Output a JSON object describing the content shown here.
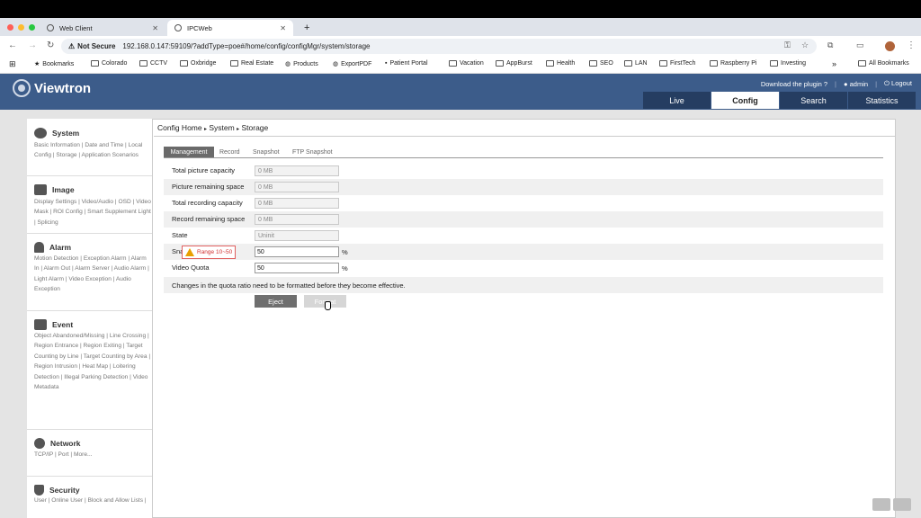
{
  "browser": {
    "tabs": [
      {
        "title": "Web Client"
      },
      {
        "title": "IPCWeb"
      }
    ],
    "new_tab": "+",
    "security": "Not Secure",
    "url": "192.168.0.147:59109/?addType=poe#/home/config/configMgr/system/storage",
    "bookmarks": [
      "Bookmarks",
      "Colorado",
      "CCTV",
      "Oxbridge",
      "Real Estate",
      "Products",
      "ExportPDF",
      "Patient Portal",
      "Vacation",
      "AppBurst",
      "Health",
      "SEO",
      "LAN",
      "FirstTech",
      "Raspberry Pi",
      "Investing"
    ],
    "more": "»",
    "all_bookmarks": "All Bookmarks"
  },
  "header": {
    "brand": "Viewtron",
    "download": "Download the plugin",
    "user": "admin",
    "logout": "Logout",
    "nav": [
      "Live",
      "Config",
      "Search",
      "Statistics"
    ],
    "active_nav": "Config"
  },
  "sidebar": {
    "system": {
      "title": "System",
      "links": "Basic Information  |  Date and Time  |  Local Config  |  Storage  |  Application Scenarios"
    },
    "image": {
      "title": "Image",
      "links": "Display Settings  |  Video/Audio  |  OSD  |  Video Mask  |  ROI Config  |  Smart Supplement Light  |  Splicing"
    },
    "alarm": {
      "title": "Alarm",
      "links": "Motion Detection  |  Exception Alarm  |  Alarm In  |  Alarm Out  |  Alarm Server  |  Audio Alarm  |  Light Alarm  |  Video Exception  |  Audio Exception"
    },
    "event": {
      "title": "Event",
      "links": "Object Abandoned/Missing  |  Line Crossing  |  Region Entrance  |  Region Exiting  |  Target Counting by Line  |  Target Counting by Area  |  Region Intrusion  |  Heat Map  |  Loitering Detection  |  Illegal Parking Detection  |  Video Metadata"
    },
    "network": {
      "title": "Network",
      "links": "TCP/IP  |  Port  |  More..."
    },
    "security": {
      "title": "Security",
      "links": "User  |  Online User  |  Block and Allow Lists  |"
    }
  },
  "breadcrumb": {
    "home": "Config Home",
    "sep": "▸",
    "section": "System",
    "page": "Storage"
  },
  "subtabs": [
    "Management",
    "Record",
    "Snapshot",
    "FTP Snapshot"
  ],
  "form": {
    "total_picture": {
      "label": "Total picture capacity",
      "value": "0 MB"
    },
    "picture_remaining": {
      "label": "Picture remaining space",
      "value": "0 MB"
    },
    "total_recording": {
      "label": "Total recording capacity",
      "value": "0 MB"
    },
    "record_remaining": {
      "label": "Record remaining space",
      "value": "0 MB"
    },
    "state": {
      "label": "State",
      "value": "Uninit"
    },
    "snapshot_quota": {
      "label": "Snapshot Quota",
      "value": "50",
      "unit": "%"
    },
    "video_quota": {
      "label": "Video Quota",
      "value": "50",
      "unit": "%"
    },
    "range_warning": "Range 10~50",
    "note": "Changes in the quota ratio need to be formatted before they become effective."
  },
  "buttons": {
    "eject": "Eject",
    "format": "Format"
  }
}
